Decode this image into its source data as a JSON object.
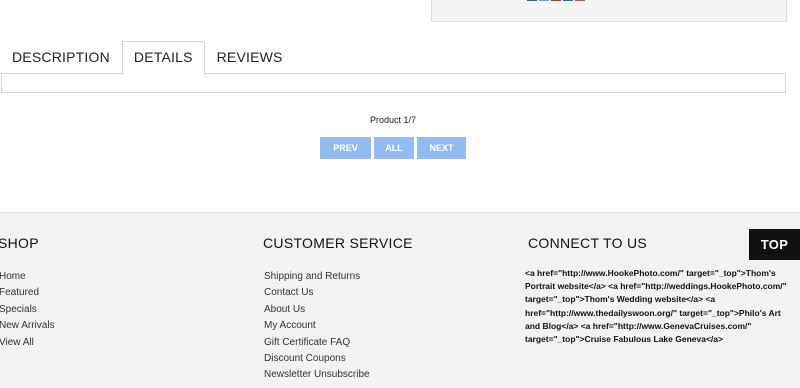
{
  "tabs": [
    {
      "label": "DESCRIPTION",
      "active": false
    },
    {
      "label": "DETAILS",
      "active": true
    },
    {
      "label": "REVIEWS",
      "active": false
    }
  ],
  "share_icon_colors": [
    "#3b5998",
    "#55acee",
    "#cb2027",
    "#0e76a8",
    "#dd4b39"
  ],
  "pager": {
    "label": "Product 1/7",
    "prev_label": "PREV",
    "all_label": "ALL",
    "next_label": "NEXT"
  },
  "footer": {
    "shop": {
      "title": "SHOP",
      "items": [
        "Home",
        "Featured",
        "Specials",
        "New Arrivals",
        "View All"
      ]
    },
    "customer_service": {
      "title": "CUSTOMER SERVICE",
      "items": [
        "Shipping and Returns",
        "Contact Us",
        "About Us",
        "My Account",
        "Gift Certificate FAQ",
        "Discount Coupons",
        "Newsletter Unsubscribe"
      ]
    },
    "connect": {
      "title": "CONNECT TO US",
      "text": "<a href=\"http://www.HookePhoto.com/\" target=\"_top\">Thom's Portrait website</a> <a href=\"http://weddings.HookePhoto.com/\" target=\"_top\">Thom's Wedding website</a> <a href=\"http://www.thedailyswoon.org/\" target=\"_top\">Philo's Art and Blog</a> <a href=\"http://www.GenevaCruises.com/\" target=\"_top\">Cruise Fabulous Lake Geneva</a>"
    },
    "top_label": "TOP"
  }
}
